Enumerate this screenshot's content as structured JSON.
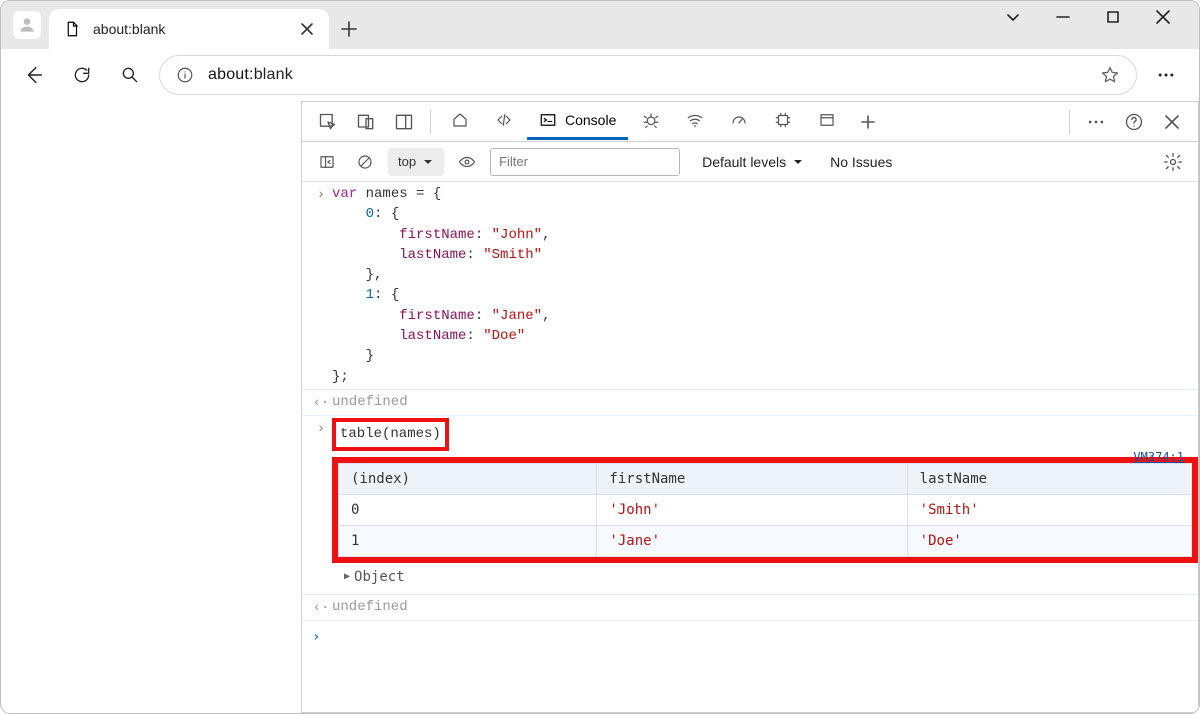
{
  "browser": {
    "tab_title": "about:blank",
    "url_display": "about:blank"
  },
  "devtools": {
    "tabs": {
      "console": "Console"
    },
    "context_label": "top",
    "filter_placeholder": "Filter",
    "levels_label": "Default levels",
    "issues_label": "No Issues"
  },
  "console": {
    "input1_lines": {
      "l1_var": "var",
      "l1_rest": " names = {",
      "l2_key": "    0",
      "l2_rest": ": {",
      "l3_attr": "        firstName",
      "l3_mid": ": ",
      "l3_str": "\"John\"",
      "l3_end": ",",
      "l4_attr": "        lastName",
      "l4_mid": ": ",
      "l4_str": "\"Smith\"",
      "l5": "    },",
      "l6_key": "    1",
      "l6_rest": ": {",
      "l7_attr": "        firstName",
      "l7_mid": ": ",
      "l7_str": "\"Jane\"",
      "l7_end": ",",
      "l8_attr": "        lastName",
      "l8_mid": ": ",
      "l8_str": "\"Doe\"",
      "l9": "    }",
      "l10": "};"
    },
    "undef": "undefined",
    "input2": "table(names)",
    "source_link": "VM374:1",
    "table": {
      "headers": {
        "c0": "(index)",
        "c1": "firstName",
        "c2": "lastName"
      },
      "rows": [
        {
          "index": "0",
          "firstName": "'John'",
          "lastName": "'Smith'"
        },
        {
          "index": "1",
          "firstName": "'Jane'",
          "lastName": "'Doe'"
        }
      ]
    },
    "object_label": "Object"
  }
}
